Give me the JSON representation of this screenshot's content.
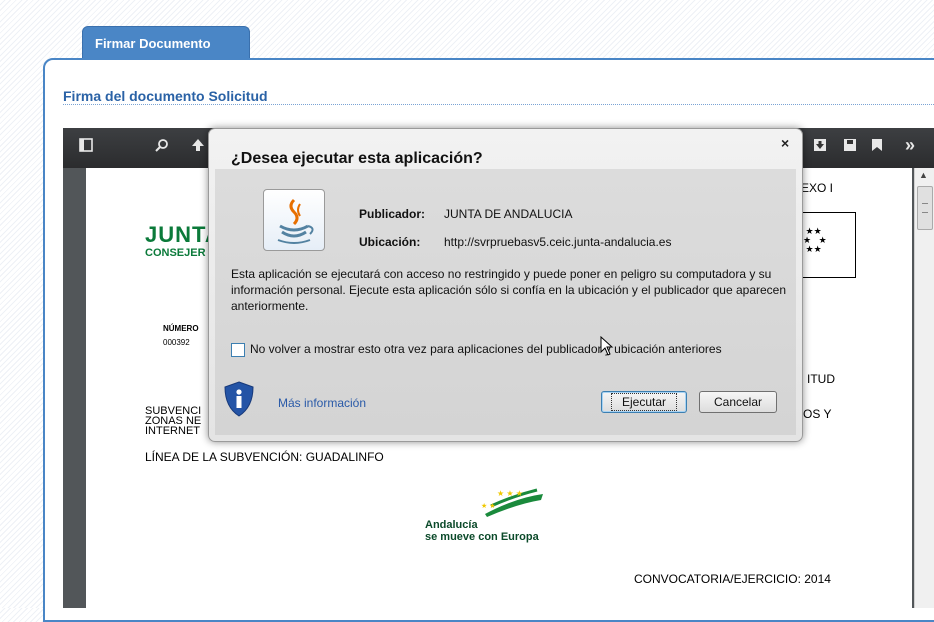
{
  "tab": {
    "label": "Firmar Documento"
  },
  "section": {
    "title": "Firma del documento Solicitud"
  },
  "pdf_toolbar": {
    "icons": [
      "sidebar-toggle-icon",
      "search-icon",
      "arrow-up-icon",
      "download-icon",
      "save-icon",
      "bookmark-icon",
      "more-tools-icon"
    ],
    "more_label": "»"
  },
  "document": {
    "anexo": "EXO I",
    "junta_logo": "JUNTA",
    "junta_sub": "CONSEJER",
    "numero_label": "NÚMERO",
    "numero_value": "000392",
    "solicitud_tail": "ITUD",
    "subvencion_lines": [
      "SUBVENCI",
      "ZONAS NE",
      "INTERNET"
    ],
    "right_tail": "OS Y",
    "linea": "LÍNEA DE LA SUBVENCIÓN: GUADALINFO",
    "andalucia_logo": [
      "Andalucía",
      "se mueve con Europa"
    ],
    "convocatoria": "CONVOCATORIA/EJERCICIO: 2014"
  },
  "dialog": {
    "title": "¿Desea ejecutar esta aplicación?",
    "close": "×",
    "publisher_label": "Publicador:",
    "publisher_value": "JUNTA DE ANDALUCIA",
    "location_label": "Ubicación:",
    "location_value": "http://svrpruebasv5.ceic.junta-andalucia.es",
    "warning": "Esta aplicación se ejecutará con acceso no restringido y puede poner en peligro su computadora y su información personal. Ejecute esta aplicación sólo si confía en la ubicación y el publicador que aparecen anteriormente.",
    "checkbox_label": "No volver a mostrar esto otra vez para aplicaciones del publicador y ubicación anteriores",
    "checkbox_checked": false,
    "more_info": "Más información",
    "run_button": "Ejecutar",
    "cancel_button": "Cancelar"
  },
  "colors": {
    "tab_bg": "#4a86c6",
    "link": "#2a5aa8",
    "junta_green": "#0b7a3a",
    "toolbar_bg": "#323336"
  }
}
